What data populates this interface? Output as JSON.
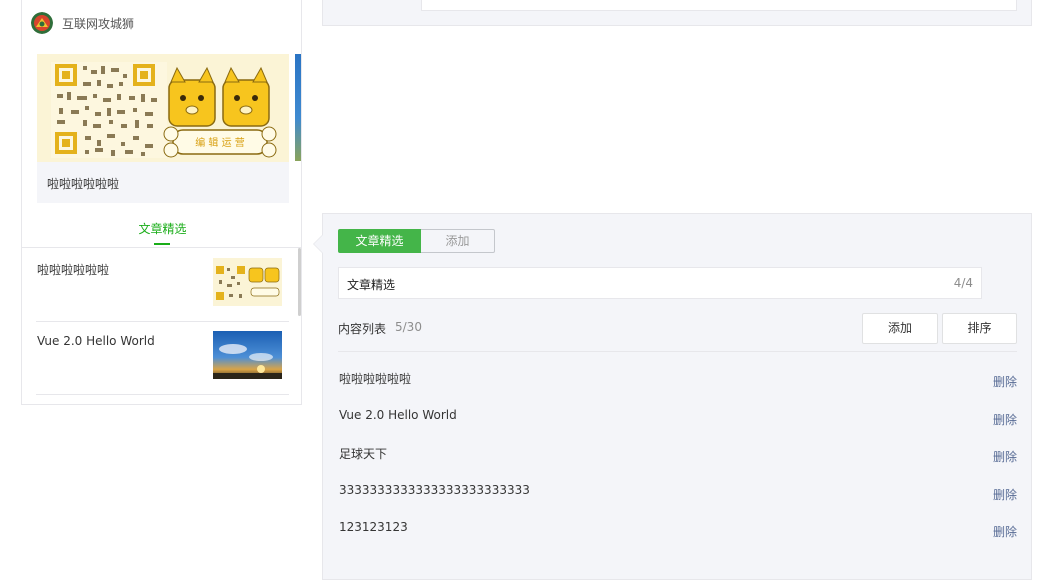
{
  "account": {
    "name": "互联网攻城狮"
  },
  "banner": {
    "caption": "啦啦啦啦啦啦",
    "badge_text": "编 辑 运 营"
  },
  "preview_tab": {
    "label": "文章精选"
  },
  "preview_articles": [
    {
      "title": "啦啦啦啦啦啦",
      "thumb": "qr-dog-thumb"
    },
    {
      "title": "Vue 2.0 Hello World",
      "thumb": "sunset-thumb"
    }
  ],
  "editor": {
    "segments": {
      "active": "文章精选",
      "inactive": "添加"
    },
    "title_value": "文章精选",
    "title_counter": "4/4",
    "content_label": "内容列表",
    "content_count": "5/30",
    "add_button": "添加",
    "sort_button": "排序",
    "items": [
      {
        "title": "啦啦啦啦啦啦",
        "delete": "删除"
      },
      {
        "title": "Vue 2.0 Hello World",
        "delete": "删除"
      },
      {
        "title": "足球天下",
        "delete": "删除"
      },
      {
        "title": "3333333333333333333333333",
        "delete": "删除"
      },
      {
        "title": "123123123",
        "delete": "删除"
      }
    ]
  },
  "colors": {
    "accent": "#44b549",
    "link": "#576b95",
    "panel": "#f4f5f9",
    "border": "#e7e7eb"
  }
}
